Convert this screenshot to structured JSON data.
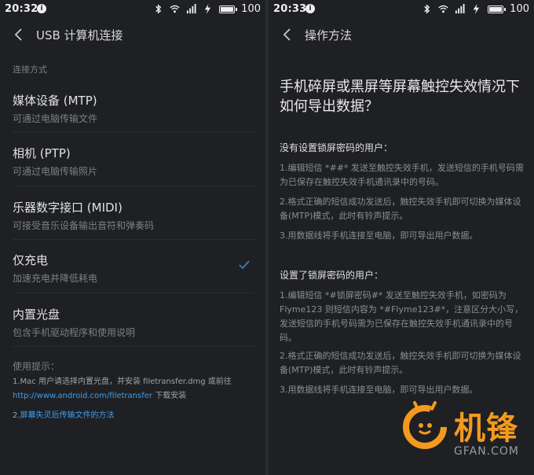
{
  "status_left": {
    "time": "20:32",
    "battery": "100",
    "battery_level": 1.0
  },
  "status_right": {
    "time": "20:33",
    "battery": "100",
    "battery_level": 1.0
  },
  "left": {
    "title": "USB 计算机连接",
    "section_label": "连接方式",
    "options": [
      {
        "title": "媒体设备 (MTP)",
        "subtitle": "可通过电脑传输文件"
      },
      {
        "title": "相机 (PTP)",
        "subtitle": "可通过电脑传输照片"
      },
      {
        "title": "乐器数字接口 (MIDI)",
        "subtitle": "可接受音乐设备输出音符和弹奏码"
      },
      {
        "title": "仅充电",
        "subtitle": "加速充电并降低耗电"
      },
      {
        "title": "内置光盘",
        "subtitle": "包含手机驱动程序和使用说明"
      }
    ],
    "selected_index": 3,
    "hint_title": "使用提示：",
    "hint1_prefix": "1.Mac 用户请选择内置光盘，并安装 filetransfer.dmg 或前往",
    "hint1_link": "http://www.android.com/filetransfer",
    "hint1_suffix": " 下载安装",
    "hint2_prefix": "2.",
    "hint2_link": "屏幕失灵后传输文件的方法"
  },
  "right": {
    "title": "操作方法",
    "heading": "手机碎屏或黑屏等屏幕触控失效情况下如何导出数据？",
    "section1_title": "没有设置锁屏密码的用户：",
    "section1_steps": [
      "1.编辑短信 *##* 发送至触控失效手机，发送短信的手机号码需为已保存在触控失效手机通讯录中的号码。",
      "2.格式正确的短信成功发送后，触控失效手机即可切换为媒体设备(MTP)模式，此时有铃声提示。",
      "3.用数据线将手机连接至电脑，即可导出用户数据。"
    ],
    "section2_title": "设置了锁屏密码的用户：",
    "section2_steps": [
      "1.编辑短信 *#锁屏密码#* 发送至触控失效手机，如密码为 Flyme123 则短信内容为 *#Flyme123#*，注意区分大小写，发送短信的手机号码需为已保存在触控失效手机通讯录中的号码。",
      "2.格式正确的短信成功发送后，触控失效手机即可切换为媒体设备(MTP)模式，此时有铃声提示。",
      "3.用数据线将手机连接至电脑，即可导出用户数据。"
    ]
  },
  "watermark": {
    "cn": "机锋",
    "en": "GFAN.COM"
  },
  "colors": {
    "background": "#1f2023",
    "accent_link": "#3d9ef0",
    "check": "#3d7fc2",
    "watermark": "#f39a1e"
  }
}
